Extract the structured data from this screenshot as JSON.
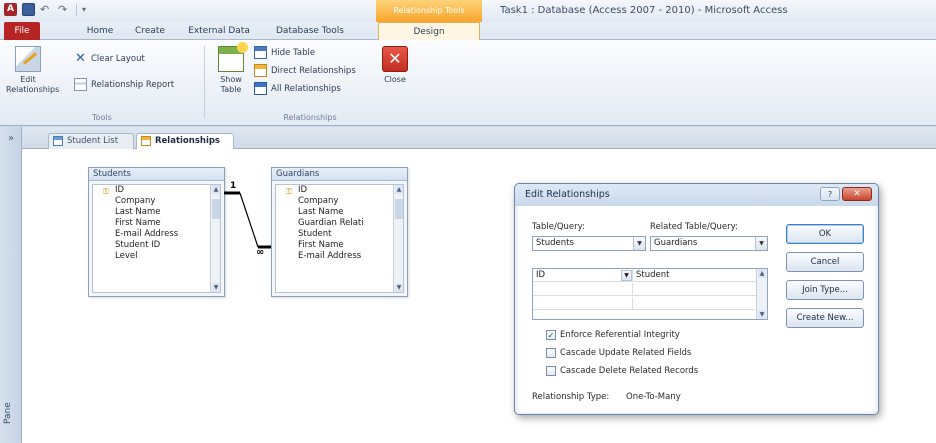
{
  "window": {
    "title": "Task1 : Database (Access 2007 - 2010) - Microsoft Access",
    "context_tab": "Relationship Tools",
    "app_letter": "A"
  },
  "qat": {
    "undo": "↶",
    "redo": "↷",
    "customize": "▾"
  },
  "ribbon_tabs": [
    {
      "label": "File"
    },
    {
      "label": "Home"
    },
    {
      "label": "Create"
    },
    {
      "label": "External Data"
    },
    {
      "label": "Database Tools"
    },
    {
      "label": "Design"
    }
  ],
  "ribbon": {
    "tools_group": {
      "label": "Tools",
      "edit_relationships": "Edit Relationships",
      "clear_layout": "Clear Layout",
      "relationship_report": "Relationship Report"
    },
    "relationships_group": {
      "label": "Relationships",
      "show_table": "Show Table",
      "hide_table": "Hide Table",
      "direct_relationships": "Direct Relationships",
      "all_relationships": "All Relationships",
      "close": "Close"
    }
  },
  "nav_pane": {
    "label": "Pane",
    "toggle": "»"
  },
  "doc_tabs": [
    {
      "label": "Student List"
    },
    {
      "label": "Relationships"
    }
  ],
  "tables": [
    {
      "title": "Students",
      "fields": [
        {
          "name": "ID",
          "key": true
        },
        {
          "name": "Company"
        },
        {
          "name": "Last Name"
        },
        {
          "name": "First Name"
        },
        {
          "name": "E-mail Address"
        },
        {
          "name": "Student ID"
        },
        {
          "name": "Level"
        }
      ]
    },
    {
      "title": "Guardians",
      "fields": [
        {
          "name": "ID",
          "key": true
        },
        {
          "name": "Company"
        },
        {
          "name": "Last Name"
        },
        {
          "name": "Guardian Relati"
        },
        {
          "name": "Student"
        },
        {
          "name": "First Name"
        },
        {
          "name": "E-mail Address"
        }
      ]
    }
  ],
  "join_line": {
    "one_label": "1",
    "many_label": "∞"
  },
  "dialog": {
    "title": "Edit Relationships",
    "help_label": "?",
    "close_label": "✕",
    "table_query_label": "Table/Query:",
    "related_table_query_label": "Related Table/Query:",
    "table_query_value": "Students",
    "related_table_query_value": "Guardians",
    "grid_rows": [
      {
        "left": "ID",
        "right": "Student"
      },
      {
        "left": "",
        "right": ""
      },
      {
        "left": "",
        "right": ""
      }
    ],
    "checkboxes": [
      {
        "label": "Enforce Referential Integrity",
        "checked": true
      },
      {
        "label": "Cascade Update Related Fields",
        "checked": false
      },
      {
        "label": "Cascade Delete Related Records",
        "checked": false
      }
    ],
    "relationship_type_label": "Relationship Type:",
    "relationship_type_value": "One-To-Many",
    "buttons": {
      "ok": "OK",
      "cancel": "Cancel",
      "join_type": "Join Type...",
      "create_new": "Create New..."
    }
  }
}
